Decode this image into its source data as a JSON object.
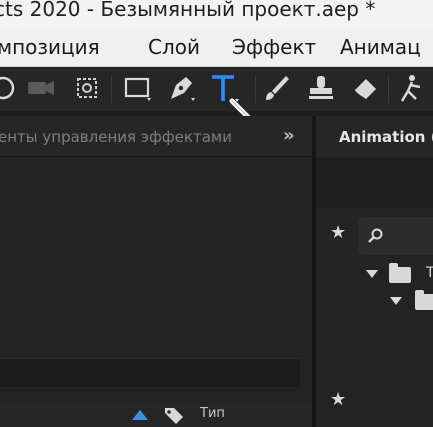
{
  "window": {
    "title": "cts 2020 - Безымянный проект.aep *"
  },
  "menu": {
    "items": [
      "мпозиция",
      "Слой",
      "Эффект",
      "Анимац"
    ]
  },
  "effects_panel": {
    "title": "енты управления эффектами",
    "more_label": "»",
    "column_type": "Тип"
  },
  "effects_presets_panel": {
    "tab_label": "Animation (",
    "folder_label": "T"
  },
  "colors": {
    "accent": "#2f8cff",
    "icon": "#d9d9d9",
    "panel_bg": "#232323"
  }
}
